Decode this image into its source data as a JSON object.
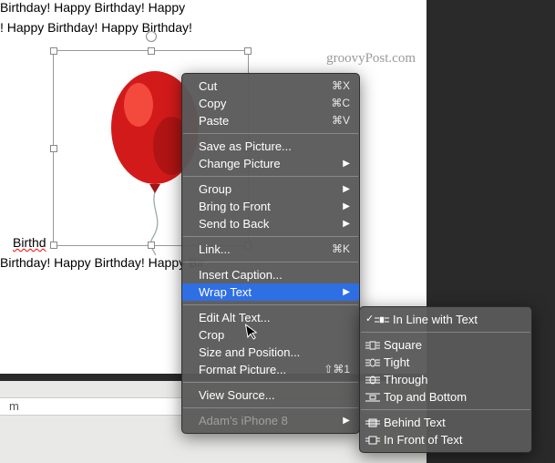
{
  "document": {
    "line1": "Birthday! Happy Birthday! Happy",
    "line2": "! Happy Birthday! Happy Birthday!",
    "line3a": "Birthd",
    "line4": "Birthday! Happy Birthday! Happy Bir"
  },
  "watermark": "groovyPost.com",
  "tab_label": "m",
  "context_menu": {
    "cut": {
      "label": "Cut",
      "shortcut": "⌘X"
    },
    "copy": {
      "label": "Copy",
      "shortcut": "⌘C"
    },
    "paste": {
      "label": "Paste",
      "shortcut": "⌘V"
    },
    "save_picture": {
      "label": "Save as Picture..."
    },
    "change_picture": {
      "label": "Change Picture"
    },
    "group": {
      "label": "Group"
    },
    "bring_front": {
      "label": "Bring to Front"
    },
    "send_back": {
      "label": "Send to Back"
    },
    "link": {
      "label": "Link...",
      "shortcut": "⌘K"
    },
    "insert_caption": {
      "label": "Insert Caption..."
    },
    "wrap_text": {
      "label": "Wrap Text"
    },
    "edit_alt": {
      "label": "Edit Alt Text..."
    },
    "crop": {
      "label": "Crop"
    },
    "size_position": {
      "label": "Size and Position..."
    },
    "format_picture": {
      "label": "Format Picture...",
      "shortcut": "⇧⌘1"
    },
    "view_source": {
      "label": "View Source..."
    },
    "device": {
      "label": "Adam's iPhone 8"
    }
  },
  "wrap_submenu": {
    "inline": {
      "label": "In Line with Text",
      "checked": true
    },
    "square": {
      "label": "Square"
    },
    "tight": {
      "label": "Tight"
    },
    "through": {
      "label": "Through"
    },
    "topbottom": {
      "label": "Top and Bottom"
    },
    "behind": {
      "label": "Behind Text"
    },
    "front": {
      "label": "In Front of Text"
    }
  }
}
